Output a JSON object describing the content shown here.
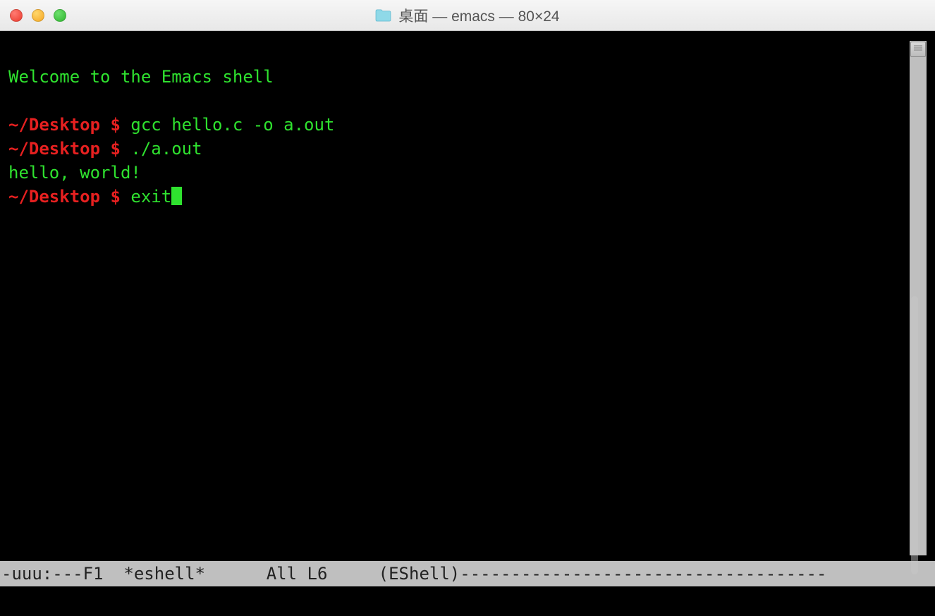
{
  "titlebar": {
    "title": "桌面 — emacs — 80×24"
  },
  "terminal": {
    "welcome": "Welcome to the Emacs shell",
    "lines": [
      {
        "prompt": "~/Desktop $ ",
        "command": "gcc hello.c -o a.out"
      },
      {
        "prompt": "~/Desktop $ ",
        "command": "./a.out"
      },
      {
        "output": "hello, world!"
      },
      {
        "prompt": "~/Desktop $ ",
        "command": "exit",
        "cursor": true
      }
    ]
  },
  "modeline": {
    "left": "-uuu:---F1",
    "buffer": "*eshell*",
    "position": "All L6",
    "mode": "(EShell)",
    "dashes": "------------------------------------"
  }
}
